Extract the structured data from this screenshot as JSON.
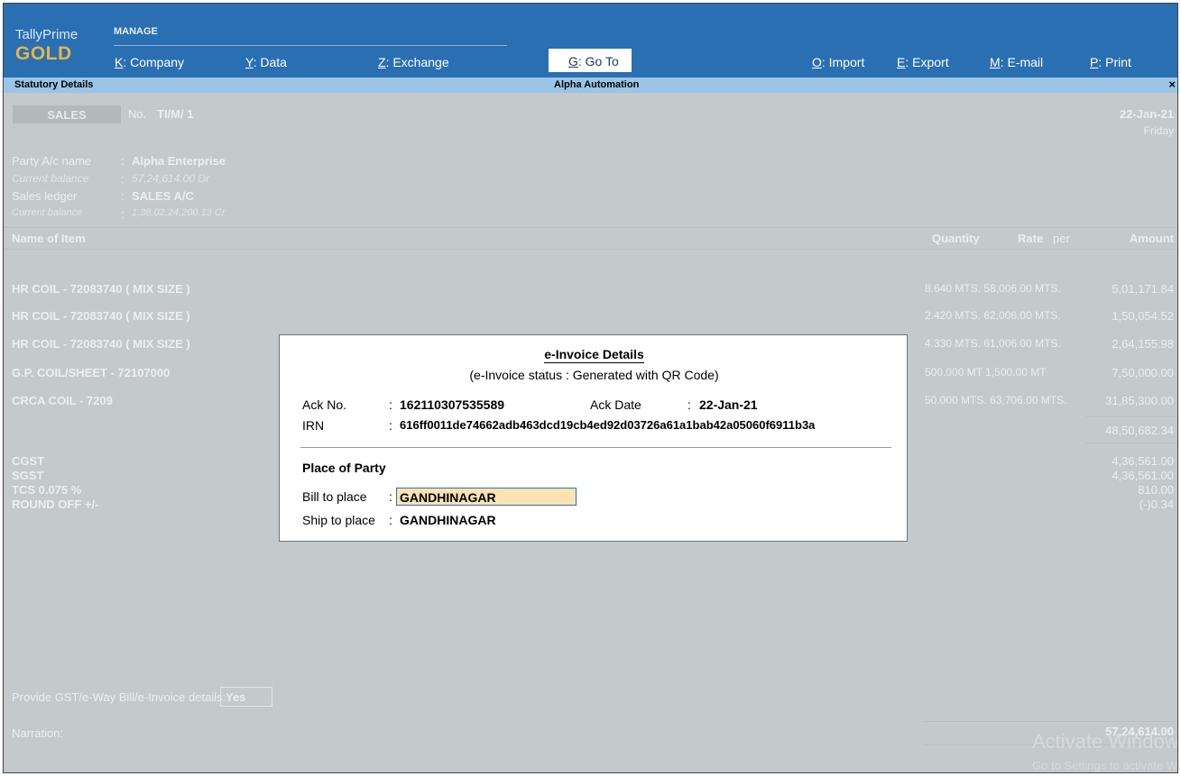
{
  "brand": {
    "line1": "TallyPrime",
    "line2": "GOLD"
  },
  "manage_label": "MANAGE",
  "menu": [
    {
      "key": "K",
      "label": ": Company"
    },
    {
      "key": "Y",
      "label": ": Data"
    },
    {
      "key": "Z",
      "label": ": Exchange"
    },
    {
      "key": "G",
      "label": ": Go To"
    },
    {
      "key": "O",
      "label": ": Import"
    },
    {
      "key": "E",
      "label": ": Export"
    },
    {
      "key": "M",
      "label": ": E-mail"
    },
    {
      "key": "P",
      "label": ": Print"
    }
  ],
  "titlebar": {
    "left": "Statutory Details",
    "center": "Alpha Automation",
    "close": "×"
  },
  "voucher": {
    "type": "SALES",
    "no_label": "No.",
    "no_value": "TI/M/  1",
    "date": "22-Jan-21",
    "day": "Friday",
    "party_label": "Party A/c name",
    "party_value": "Alpha Enterprise",
    "party_bal_label": "Current balance",
    "party_bal_value": "57,24,614.00 Dr",
    "ledger_label": "Sales ledger",
    "ledger_value": "SALES A/C",
    "ledger_bal_label": "Current balance",
    "ledger_bal_value": "1,38,02,24,200.13 Cr",
    "sep": ":"
  },
  "table": {
    "headers": {
      "name": "Name of Item",
      "qty": "Quantity",
      "rate": "Rate",
      "per": "per",
      "amount": "Amount"
    },
    "rows": [
      {
        "name": "HR COIL - 72083740  ( MIX SIZE )",
        "detail": "8.640 MTS. 58,006.00 MTS.",
        "amount": "5,01,171.84"
      },
      {
        "name": "HR COIL - 72083740  ( MIX SIZE )",
        "detail": "2.420 MTS. 62,006.00 MTS.",
        "amount": "1,50,054.52"
      },
      {
        "name": "HR COIL - 72083740  ( MIX SIZE )",
        "detail": "4.330 MTS. 61,006.00 MTS.",
        "amount": "2,64,155.98"
      },
      {
        "name": "G.P. COIL/SHEET - 72107000",
        "detail": "500.000 MT  1,500.00 MT",
        "amount": "7,50,000.00"
      },
      {
        "name": "CRCA  COIL - 7209",
        "detail": "50.000 MTS. 63,706.00 MTS.",
        "amount": "31,85,300.00"
      }
    ],
    "subtotal": "48,50,682.34",
    "taxes": [
      {
        "name": "CGST",
        "amount": "4,36,561.00"
      },
      {
        "name": "SGST",
        "amount": "4,36,561.00"
      },
      {
        "name": "TCS 0.075 %",
        "amount": "810.00"
      },
      {
        "name": "ROUND OFF +/-",
        "amount": "(-)0.34"
      }
    ]
  },
  "gst_prompt": {
    "label": "Provide GST/e-Way Bill/e-Invoice details:",
    "value": "Yes"
  },
  "narration_label": "Narration:",
  "total": "57,24,614.00",
  "modal": {
    "title": "e-Invoice Details",
    "status": "(e-Invoice status : Generated with QR Code)",
    "ack_no_label": "Ack No.",
    "ack_no_value": "162110307535589",
    "ack_date_label": "Ack Date",
    "ack_date_value": "22-Jan-21",
    "irn_label": "IRN",
    "irn_value": "616ff0011de74662adb463dcd19cb4ed92d03726a61a1bab42a05060f6911b3a",
    "section": "Place of Party",
    "bill_label": "Bill to place",
    "bill_value": "GANDHINAGAR",
    "ship_label": "Ship to place",
    "ship_value": "GANDHINAGAR",
    "sep": ":"
  },
  "watermark": {
    "line1": "Activate Windows",
    "line2": "Go to Settings to activate Windows."
  },
  "colors": {
    "topbar": "#2a6fb1",
    "gold": "#e8b44a",
    "strip": "#9bc5e6",
    "dim_bg": "#c4c9cc",
    "input_bg": "#fce3b3"
  }
}
